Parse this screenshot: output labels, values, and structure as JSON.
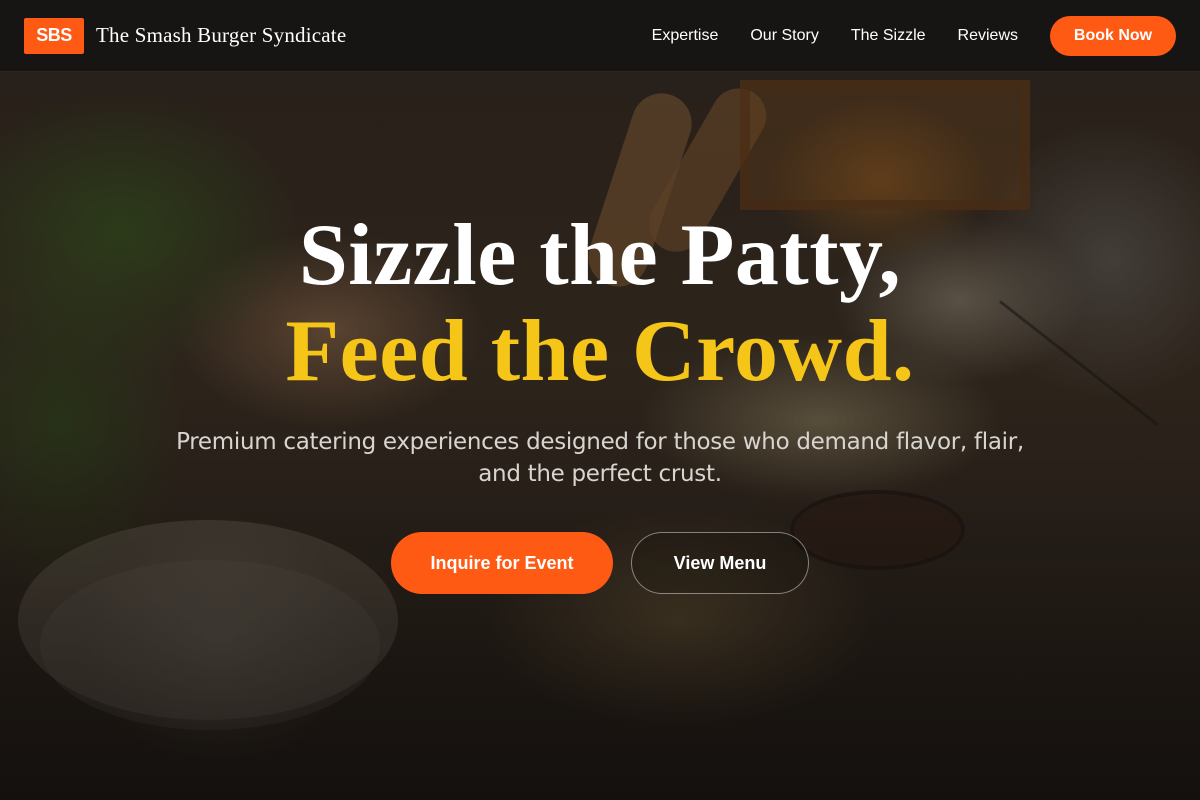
{
  "nav": {
    "logo_badge": "SBS",
    "brand_name": "The Smash Burger Syndicate",
    "links": [
      "Expertise",
      "Our Story",
      "The Sizzle",
      "Reviews"
    ],
    "cta_label": "Book Now"
  },
  "hero": {
    "headline_line1": "Sizzle the Patty,",
    "headline_line2": "Feed the Crowd.",
    "subheadline": "Premium catering experiences designed for those who demand flavor, flair, and the perfect crust.",
    "primary_cta": "Inquire for Event",
    "secondary_cta": "View Menu"
  },
  "colors": {
    "accent": "#ff5a14",
    "headline_highlight": "#f5c518",
    "nav_background": "#161413"
  }
}
